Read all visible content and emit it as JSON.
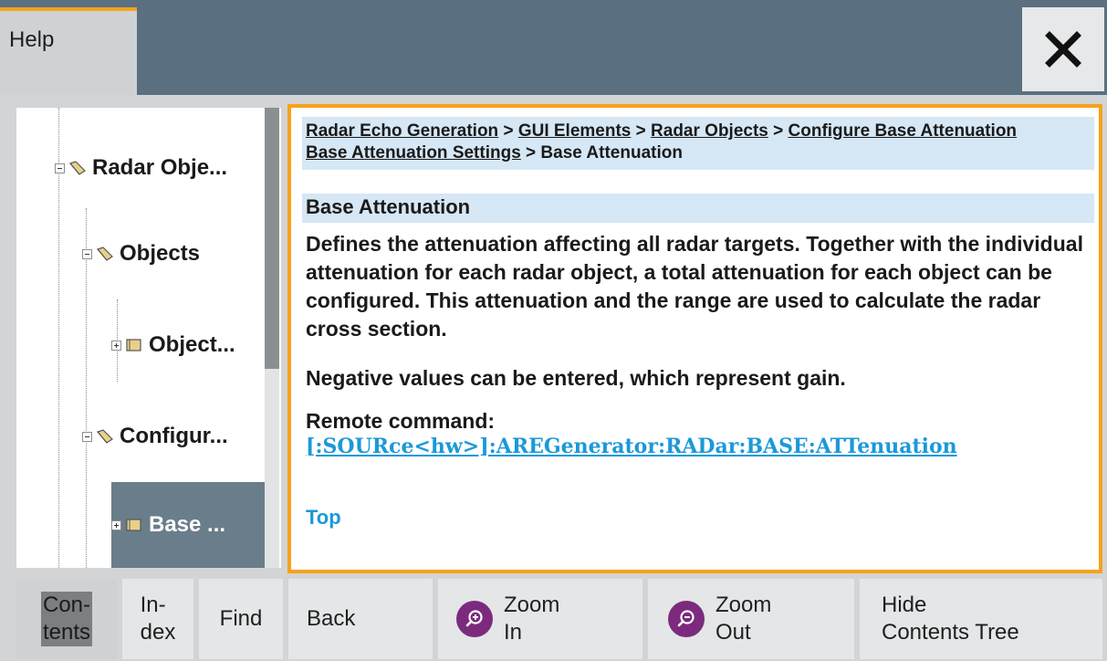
{
  "header": {
    "tab_label": "Help",
    "close_label": "Close"
  },
  "tree": {
    "items": [
      {
        "label": "Radar Obje...",
        "expander": "minus",
        "selected": false
      },
      {
        "label": "Objects",
        "expander": "minus",
        "selected": false
      },
      {
        "label": "Object...",
        "expander": "plus",
        "selected": false
      },
      {
        "label": "Configur...",
        "expander": "minus",
        "selected": false
      },
      {
        "label": "Base ...",
        "expander": "plus",
        "selected": true
      }
    ]
  },
  "content": {
    "breadcrumb": {
      "links": [
        "Radar Echo Generation",
        "GUI Elements",
        "Radar Objects",
        "Configure Base Attenuation",
        "Base Attenuation Settings"
      ],
      "current": "Base Attenuation",
      "separator": " > "
    },
    "title": "Base Attenuation",
    "description": "Defines the attenuation affecting all radar targets. Together with the individual attenuation for each radar object, a total attenuation for each object can be configured. This attenuation and the range are used to calculate the radar cross section.",
    "note": "Negative values can be entered, which represent gain.",
    "remote_label": "Remote command:",
    "remote_command": "[:SOURce<hw>]:AREGenerator:RADar:BASE:ATTenuation",
    "top_link": "Top"
  },
  "toolbar": {
    "contents": {
      "line1": "Con-",
      "line2": "tents"
    },
    "index": {
      "line1": "In-",
      "line2": "dex"
    },
    "find": "Find",
    "back": "Back",
    "zoom_in": {
      "line1": "Zoom",
      "line2": "In"
    },
    "zoom_out": {
      "line1": "Zoom",
      "line2": "Out"
    },
    "hide_tree": {
      "line1": "Hide",
      "line2": "Contents Tree"
    }
  },
  "colors": {
    "accent": "#f7a21b",
    "header_bg": "#5a7080",
    "link": "#1b99d8",
    "highlight_bg": "#d6e7f5",
    "zoom_icon": "#7c2a7d",
    "selected_node": "#6a7d8b"
  }
}
